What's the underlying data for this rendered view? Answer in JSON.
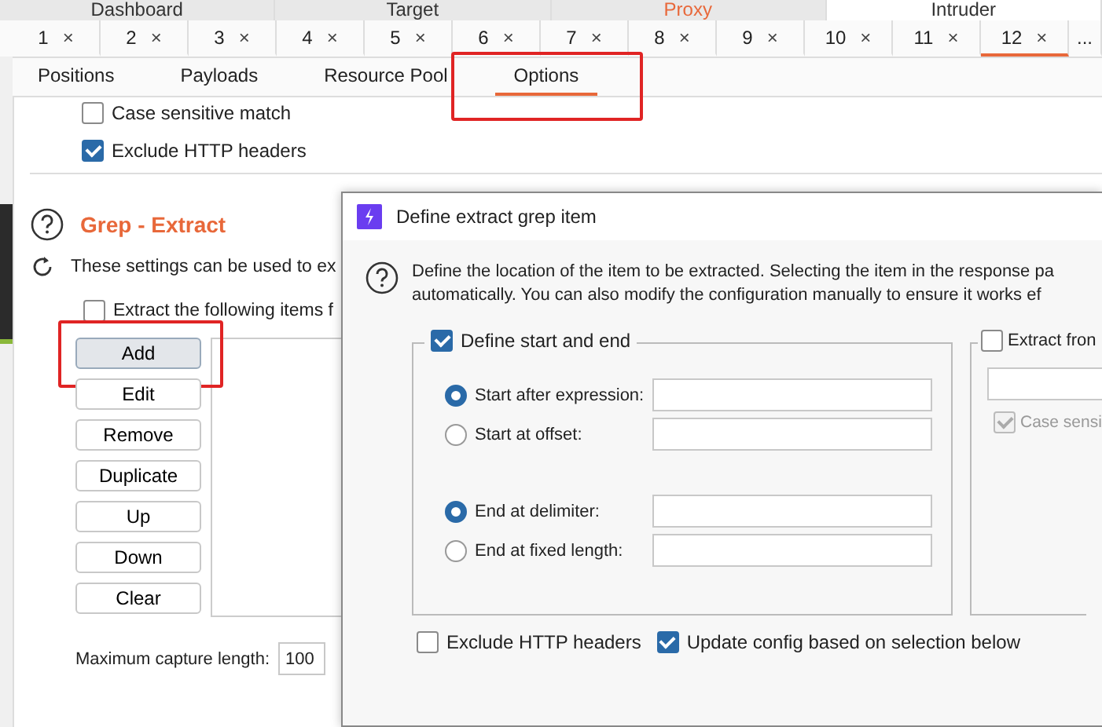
{
  "main_tabs": [
    {
      "label": "Dashboard",
      "selected": false,
      "highlighted": false
    },
    {
      "label": "Target",
      "selected": false,
      "highlighted": false
    },
    {
      "label": "Proxy",
      "selected": false,
      "highlighted": true
    },
    {
      "label": "Intruder",
      "selected": true,
      "highlighted": false
    }
  ],
  "attack_tabs": [
    {
      "label": "1",
      "close": "×",
      "selected": false
    },
    {
      "label": "2",
      "close": "×",
      "selected": false
    },
    {
      "label": "3",
      "close": "×",
      "selected": false
    },
    {
      "label": "4",
      "close": "×",
      "selected": false
    },
    {
      "label": "5",
      "close": "×",
      "selected": false
    },
    {
      "label": "6",
      "close": "×",
      "selected": false
    },
    {
      "label": "7",
      "close": "×",
      "selected": false
    },
    {
      "label": "8",
      "close": "×",
      "selected": false
    },
    {
      "label": "9",
      "close": "×",
      "selected": false
    },
    {
      "label": "10",
      "close": "×",
      "selected": false
    },
    {
      "label": "11",
      "close": "×",
      "selected": false
    },
    {
      "label": "12",
      "close": "×",
      "selected": true
    },
    {
      "label": "...",
      "selected": false
    }
  ],
  "sub_tabs": [
    {
      "label": "Positions",
      "selected": false,
      "annotated": false
    },
    {
      "label": "Payloads",
      "selected": false,
      "annotated": false
    },
    {
      "label": "Resource Pool",
      "selected": false,
      "annotated": false
    },
    {
      "label": "Options",
      "selected": true,
      "annotated": true
    }
  ],
  "match_options": [
    {
      "label": "Case sensitive match",
      "checked": false
    },
    {
      "label": "Exclude HTTP headers",
      "checked": true
    }
  ],
  "grep_extract": {
    "title": "Grep - Extract",
    "description": "These settings can be used to ex",
    "extract_option": {
      "label": "Extract the following items f",
      "checked": false
    },
    "buttons": [
      {
        "label": "Add",
        "selected": true,
        "annotated": true
      },
      {
        "label": "Edit",
        "selected": false,
        "annotated": false
      },
      {
        "label": "Remove",
        "selected": false,
        "annotated": false
      },
      {
        "label": "Duplicate",
        "selected": false,
        "annotated": false
      },
      {
        "label": "Up",
        "selected": false,
        "annotated": false
      },
      {
        "label": "Down",
        "selected": false,
        "annotated": false
      },
      {
        "label": "Clear",
        "selected": false,
        "annotated": false
      }
    ],
    "max_capture": {
      "label": "Maximum capture length:",
      "value": "100"
    }
  },
  "dialog": {
    "title": "Define extract grep item",
    "description_lines": [
      "Define the location of the item to be extracted. Selecting the item in the response pa",
      "automatically. You can also modify the configuration manually to ensure it works ef"
    ],
    "start_end_group": {
      "label": "Define start and end",
      "checked": true,
      "start_options": [
        {
          "label": "Start after expression:",
          "selected": true
        },
        {
          "label": "Start at offset:",
          "selected": false
        }
      ],
      "end_options": [
        {
          "label": "End at delimiter:",
          "selected": true
        },
        {
          "label": "End at fixed length:",
          "selected": false
        }
      ]
    },
    "regex_group": {
      "label": "Extract fron",
      "checked": false,
      "case_option": {
        "label": "Case sensi",
        "checked": true,
        "disabled": true
      }
    },
    "bottom_options": [
      {
        "label": "Exclude HTTP headers",
        "checked": false
      },
      {
        "label": "Update config based on selection below",
        "checked": true
      }
    ]
  }
}
